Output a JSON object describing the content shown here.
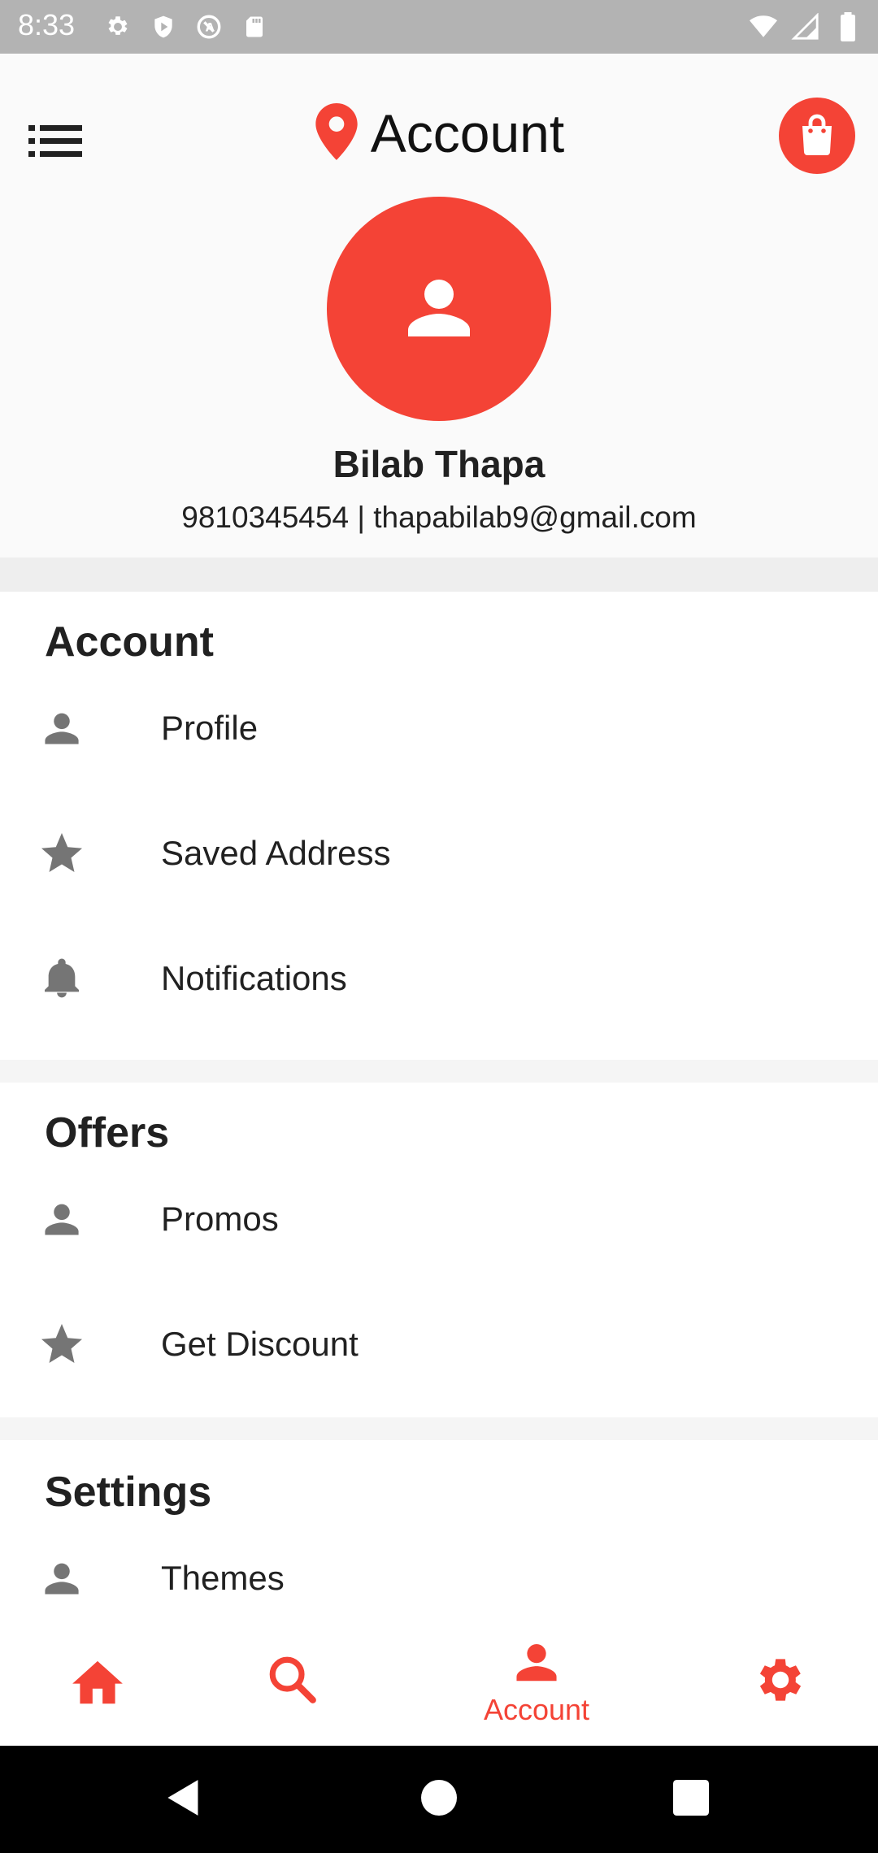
{
  "status_bar": {
    "time": "8:33",
    "left_icons": [
      "settings-icon",
      "play-protect-icon",
      "no-sim-icon",
      "sd-card-icon"
    ],
    "right_icons": [
      "wifi-icon",
      "signal-icon",
      "battery-icon"
    ]
  },
  "header": {
    "title": "Account",
    "menu_icon": "list-menu-icon",
    "location_icon": "location-pin-icon",
    "cart_icon": "shopping-bag-icon"
  },
  "profile": {
    "name": "Bilab Thapa",
    "contact": "9810345454 | thapabilab9@gmail.com",
    "avatar_icon": "person-icon"
  },
  "sections": {
    "account": {
      "title": "Account",
      "items": [
        {
          "label": "Profile",
          "icon": "person-icon"
        },
        {
          "label": "Saved Address",
          "icon": "star-icon"
        },
        {
          "label": "Notifications",
          "icon": "bell-icon"
        }
      ]
    },
    "offers": {
      "title": "Offers",
      "items": [
        {
          "label": "Promos",
          "icon": "person-icon"
        },
        {
          "label": "Get Discount",
          "icon": "star-icon"
        }
      ]
    },
    "settings": {
      "title": "Settings",
      "items": [
        {
          "label": "Themes",
          "icon": "person-icon"
        }
      ]
    }
  },
  "bottom_nav": {
    "items": [
      {
        "icon": "home-icon",
        "label": ""
      },
      {
        "icon": "search-icon",
        "label": ""
      },
      {
        "icon": "person-icon",
        "label": "Account",
        "active": true
      },
      {
        "icon": "gear-icon",
        "label": ""
      }
    ]
  },
  "colors": {
    "accent": "#f44336",
    "status_bar": "#b3b3b3",
    "icon_gray": "#757575",
    "header_bg": "#fafafa",
    "divider": "#eeeeee"
  }
}
